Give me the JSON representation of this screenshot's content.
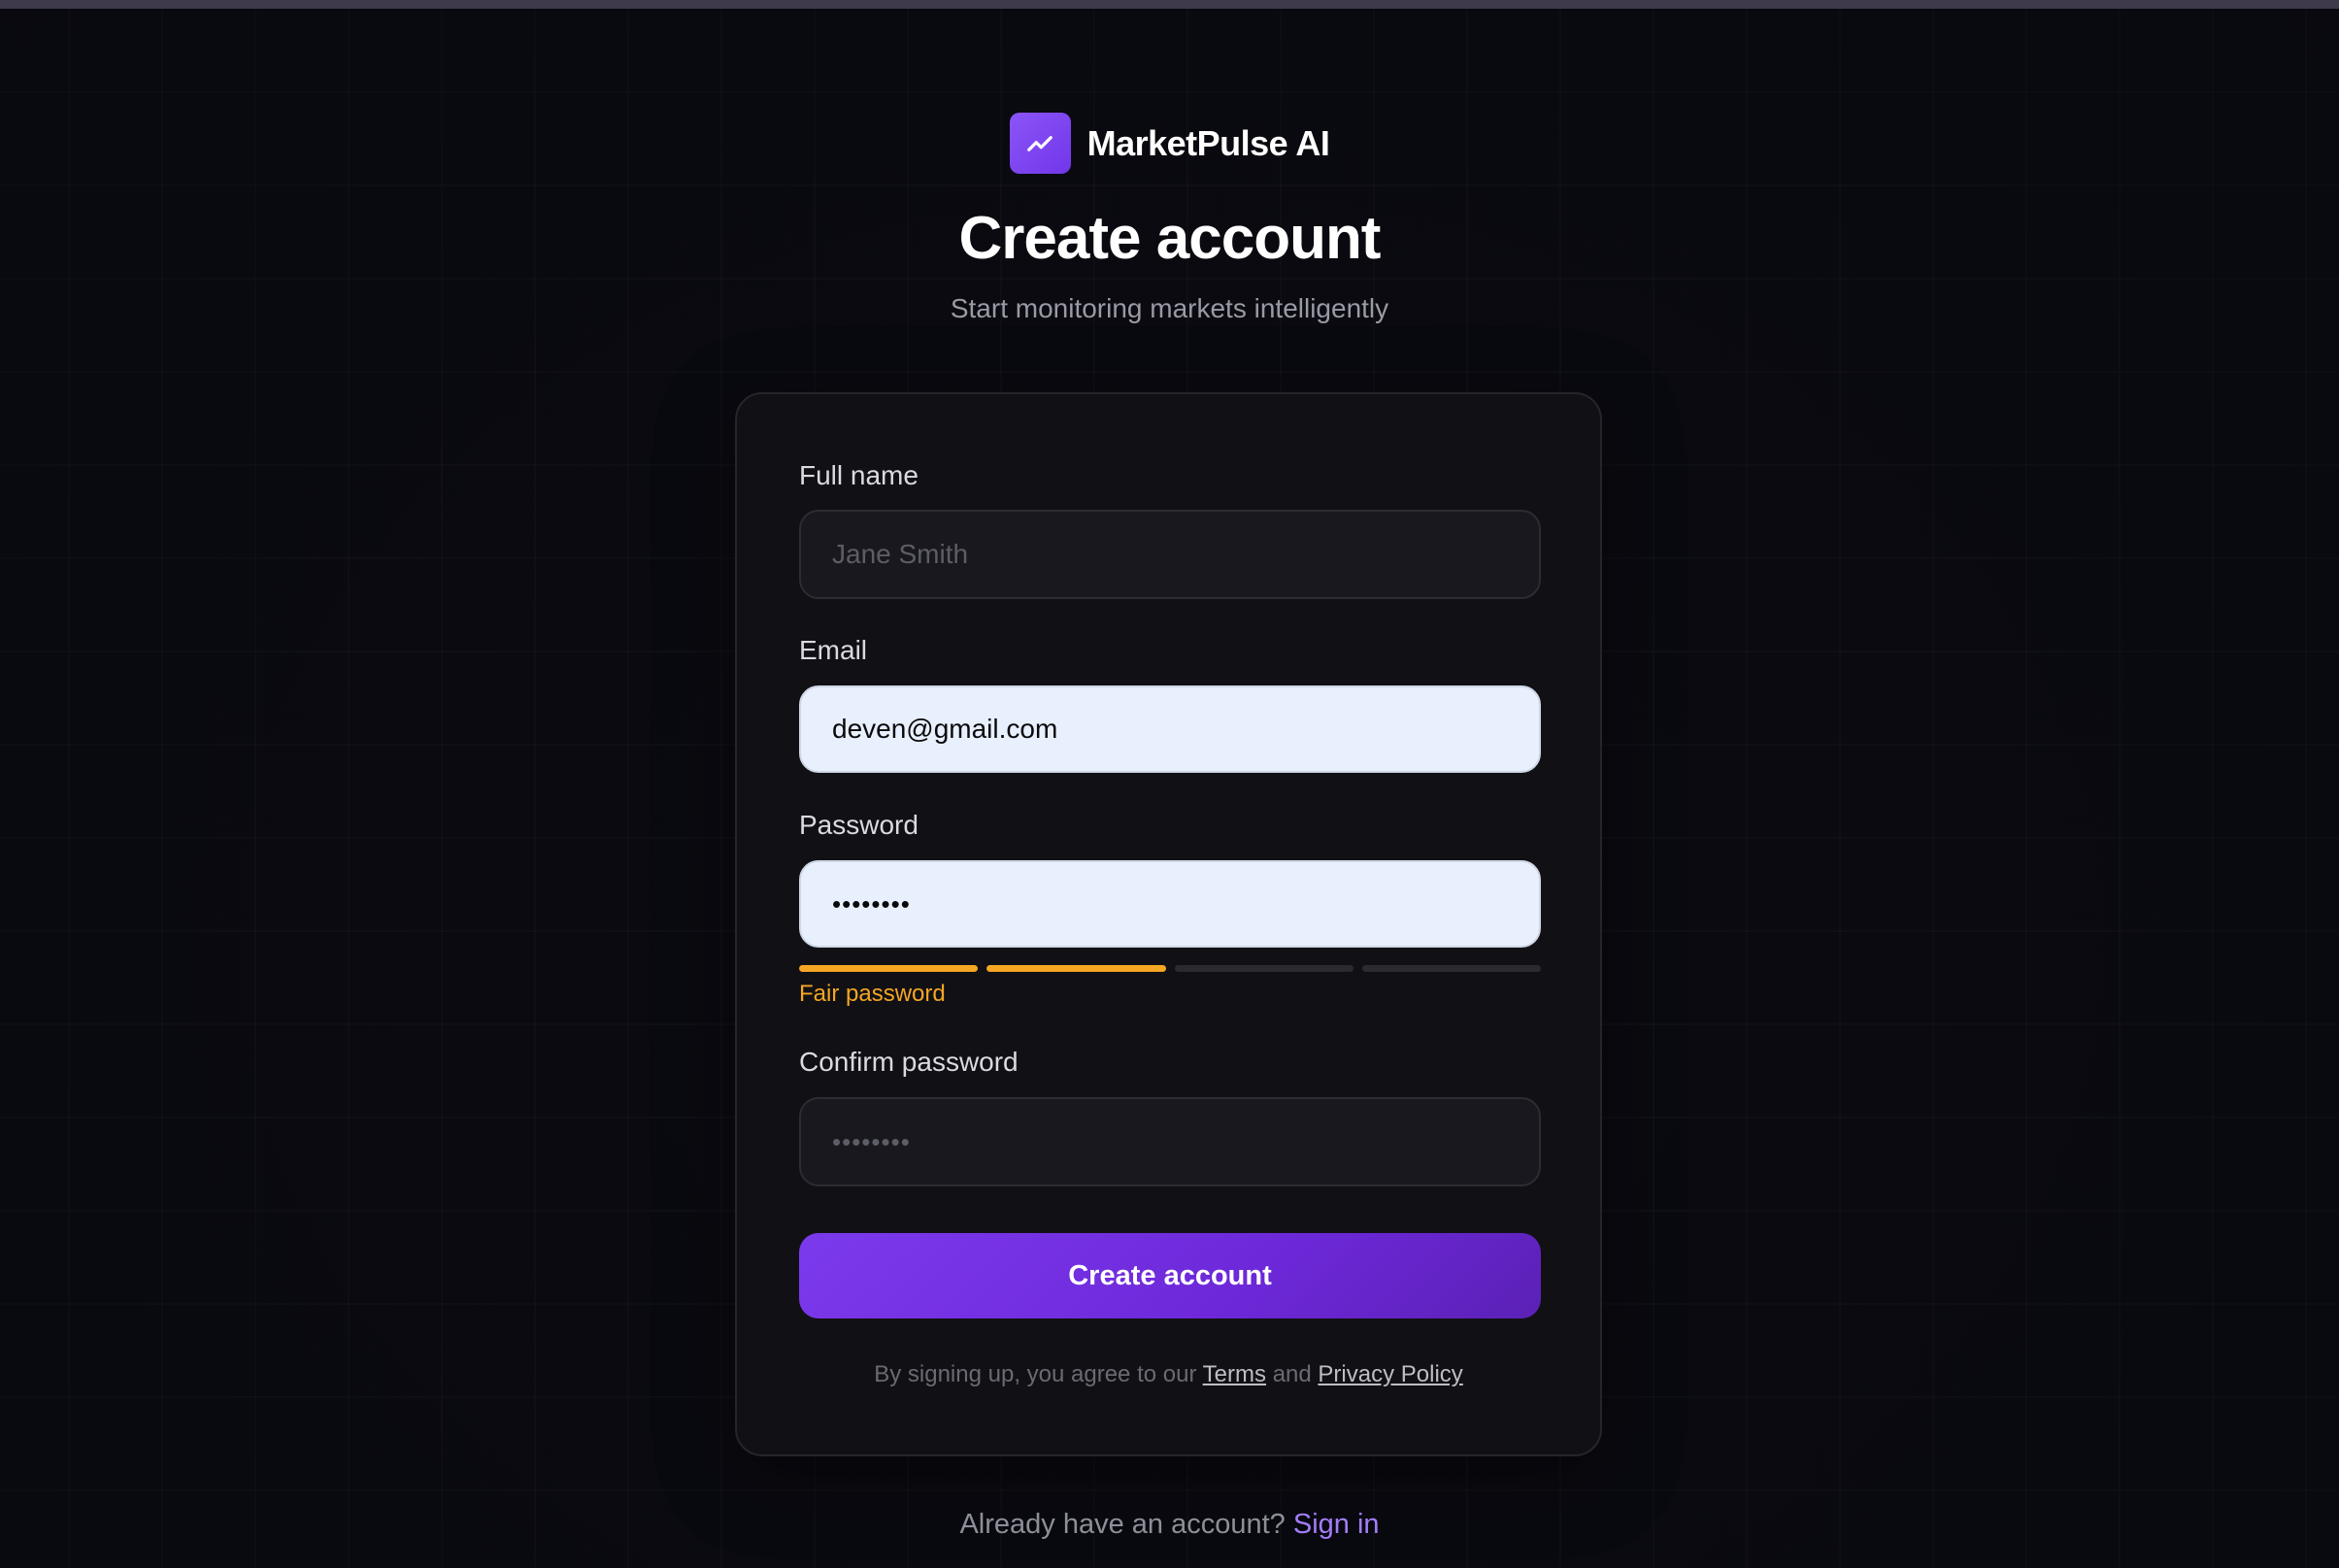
{
  "brand": {
    "name": "MarketPulse AI",
    "logo_icon": "trending-up-icon",
    "accent_color": "#8b5cf6"
  },
  "header": {
    "title": "Create account",
    "subtitle": "Start monitoring markets intelligently"
  },
  "form": {
    "full_name": {
      "label": "Full name",
      "placeholder": "Jane Smith",
      "value": ""
    },
    "email": {
      "label": "Email",
      "value": "deven@gmail.com"
    },
    "password": {
      "label": "Password",
      "value": "abcd1234",
      "strength": {
        "label": "Fair password",
        "filled_segments": 2,
        "total_segments": 4,
        "color": "#f5a623",
        "empty_color": "#2a2a31"
      }
    },
    "confirm_password": {
      "label": "Confirm password",
      "placeholder": "••••••••",
      "value": ""
    },
    "submit_label": "Create account"
  },
  "terms": {
    "prefix": "By signing up, you agree to our",
    "terms_link": "Terms",
    "conjunction": "and",
    "privacy_link": "Privacy Policy"
  },
  "footer": {
    "prompt": "Already have an account?",
    "signin_link": "Sign in"
  }
}
